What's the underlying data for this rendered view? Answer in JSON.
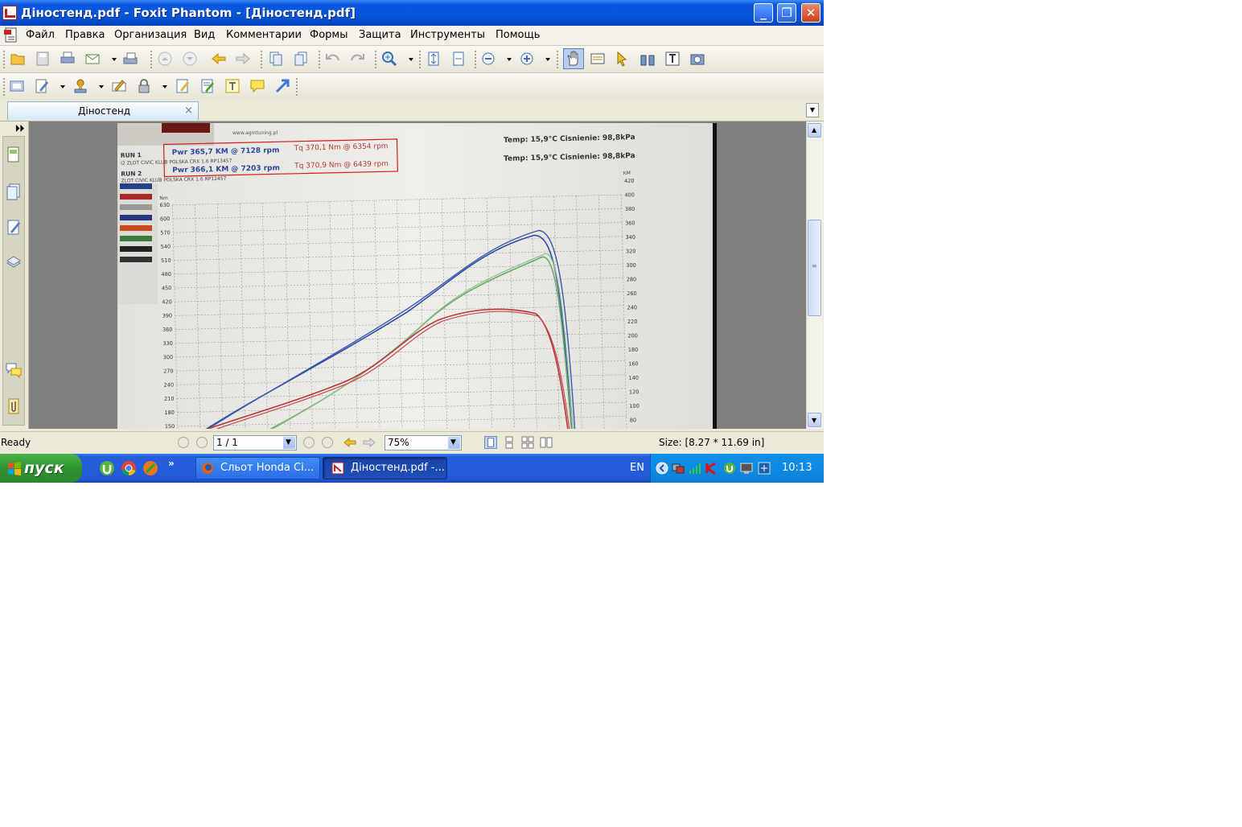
{
  "window": {
    "title": "Діностенд.pdf - Foxit Phantom - [Діностенд.pdf]"
  },
  "menu": {
    "items": [
      "Файл",
      "Правка",
      "Организация",
      "Вид",
      "Комментарии",
      "Формы",
      "Защита",
      "Инструменты",
      "Помощь"
    ]
  },
  "tab": {
    "label": "Діностенд",
    "close": "×"
  },
  "document": {
    "run1_label": "RUN 1",
    "run1_sub": "I2 ZLOT CIVIC KLUB POLSKA CRX 1.6 RP13457",
    "run1_pwr": "Pwr 365,7 KM @ 7128 rpm",
    "run1_tq": "Tq 370,1 Nm @ 6354 rpm",
    "run2_label": "RUN 2",
    "run2_sub": "ZLOT CIVIC KLUB POLSKA CRX 1.6 RP12457",
    "run2_pwr": "Pwr 366,1 KM @ 7203 rpm",
    "run2_tq": "Tq 370,9 Nm @ 6439 rpm",
    "cond1": "Temp: 15,9°C    Cisnienie: 98,8kPa",
    "cond2": "Temp: 15,9°C    Cisnienie: 98,8kPa",
    "site": "www.agmtuning.pl",
    "left_unit": "Nm",
    "right_unit": "KM",
    "left_ticks": [
      "630",
      "600",
      "570",
      "540",
      "510",
      "480",
      "450",
      "420",
      "390",
      "360",
      "330",
      "300",
      "270",
      "240",
      "210",
      "180",
      "150"
    ],
    "right_ticks": [
      "420",
      "400",
      "380",
      "360",
      "340",
      "320",
      "300",
      "280",
      "260",
      "240",
      "220",
      "200",
      "180",
      "160",
      "140",
      "120",
      "100",
      "80"
    ]
  },
  "status": {
    "ready": "Ready",
    "page": "1 / 1",
    "zoom": "75%",
    "size": "Size: [8.27 * 11.69 in]"
  },
  "taskbar": {
    "start": "пуск",
    "tasks": [
      "Сльот Honda Ci...",
      "Діностенд.pdf -..."
    ],
    "lang": "EN",
    "clock": "10:13",
    "more": "»"
  }
}
